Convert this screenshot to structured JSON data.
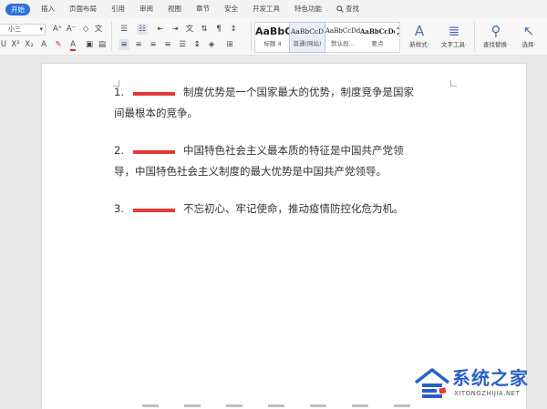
{
  "ribbon": {
    "tabs": [
      "开始",
      "插入",
      "页面布局",
      "引用",
      "审阅",
      "视图",
      "章节",
      "安全",
      "开发工具",
      "特色功能"
    ],
    "active_tab": 0,
    "search_label": "查找",
    "font_size": "小三",
    "styles": [
      {
        "sample": "AaBbC",
        "caption": "标题 4"
      },
      {
        "sample": "AaBbCcD",
        "caption": "普通(网站)"
      },
      {
        "sample": "AaBbCcDd",
        "caption": "默认段..."
      },
      {
        "sample": "AaBbCcDd",
        "caption": "要点"
      }
    ],
    "new_style_label": "新样式·",
    "text_tool_label": "文字工具·",
    "find_replace_label": "查找替换·",
    "select_label": "选择·",
    "accent": "#2f6fde"
  },
  "document": {
    "paragraphs": [
      {
        "num": "1.",
        "line1": "制度优势是一个国家最大的优势，制度竞争是国家",
        "line2": "间最根本的竞争。"
      },
      {
        "num": "2.",
        "line1": "中国特色社会主义最本质的特征是中国共产党领",
        "line2": "导，中国特色社会主义制度的最大优势是中国共产党领导。"
      },
      {
        "num": "3.",
        "line1": "不忘初心、牢记使命，推动疫情防控化危为机。",
        "line2": ""
      }
    ],
    "blank_color": "#e23b3b"
  },
  "watermark": {
    "title": "系统之家",
    "subtitle": "XITONGZHIJIA.NET",
    "color": "#2b5fc8"
  }
}
